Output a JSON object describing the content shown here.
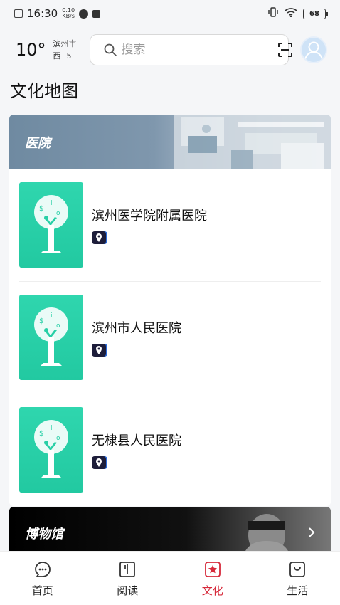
{
  "status_bar": {
    "time": "16:30",
    "speed_value": "0.10",
    "speed_unit": "KB/s",
    "battery": "68"
  },
  "header": {
    "temperature": "10°",
    "city": "滨州市",
    "wind_dir": "西",
    "wind_level": "5",
    "search_placeholder": "搜索"
  },
  "section": {
    "title": "文化地图"
  },
  "hospital_card": {
    "banner_label": "医院",
    "items": [
      {
        "name": "滨州医学院附属医院"
      },
      {
        "name": "滨州市人民医院"
      },
      {
        "name": "无棣县人民医院"
      }
    ]
  },
  "museum_card": {
    "banner_label": "博物馆"
  },
  "bottom_nav": {
    "items": [
      {
        "label": "首页",
        "icon": "home-chat-icon"
      },
      {
        "label": "阅读",
        "icon": "book-icon"
      },
      {
        "label": "文化",
        "icon": "culture-star-icon",
        "active": true
      },
      {
        "label": "生活",
        "icon": "bag-icon"
      }
    ]
  },
  "colors": {
    "accent": "#d6293a",
    "thumb_green": "#2fd6ae",
    "background": "#f5f6f8"
  }
}
